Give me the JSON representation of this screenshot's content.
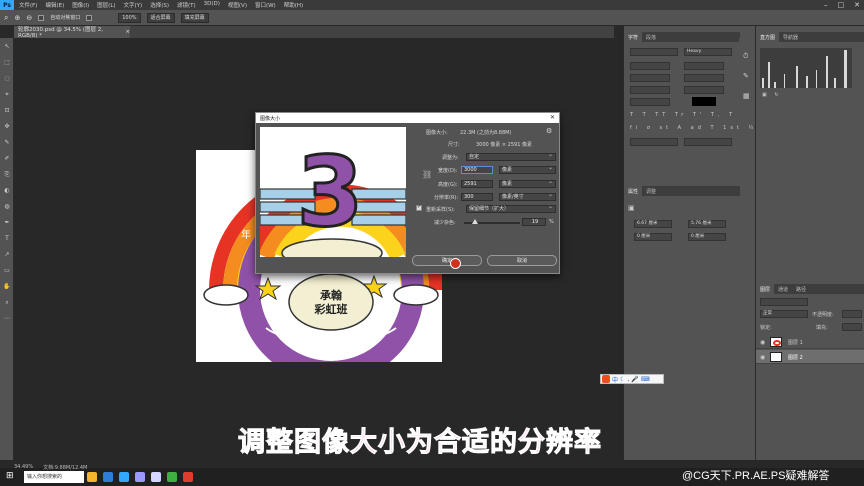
{
  "app": {
    "logo": "Ps",
    "menu": [
      "文件(F)",
      "编辑(E)",
      "图像(I)",
      "图层(L)",
      "文字(Y)",
      "选择(S)",
      "滤镜(T)",
      "3D(D)",
      "视图(V)",
      "窗口(W)",
      "帮助(H)"
    ],
    "window_controls": [
      "–",
      "□",
      "✕"
    ]
  },
  "options_bar": {
    "auto_select_label": "自动对焦窗口",
    "zoom_value": "100%",
    "fit_screen": "适合屏幕",
    "fill_screen": "填充屏幕"
  },
  "document_tab": {
    "title": "轮廓2030.psd @ 34.5% (图层 2, RGB/8) *",
    "close": "×"
  },
  "dialog": {
    "title": "图像大小",
    "close": "✕",
    "image_size_label": "图像大小:",
    "image_size_value": "22.3M (之前为8.88M)",
    "gear_icon": "gear-icon",
    "dimensions_label": "尺寸:",
    "dimensions_value": "3000 像素 × 2591 像素",
    "fit_label": "调整为:",
    "fit_value": "自定",
    "width_label": "宽度(D):",
    "width_value": "3000",
    "width_unit": "像素",
    "height_label": "高度(G):",
    "height_value": "2591",
    "height_unit": "像素",
    "resolution_label": "分辨率(R):",
    "resolution_value": "300",
    "resolution_unit": "像素/英寸",
    "resample_label": "重新采样(S):",
    "resample_checked": true,
    "resample_value": "保留细节（扩大）",
    "noise_label": "减少杂色:",
    "noise_value": "19",
    "noise_unit": "%",
    "noise_level": 0.19,
    "ok_label": "确定",
    "cancel_label": "取消"
  },
  "artwork": {
    "number": "3",
    "line1": "承翰",
    "line2": "彩虹班",
    "side_text": "年"
  },
  "right_panel": {
    "char_tabs": [
      "字符",
      "段落"
    ],
    "font_value": "Heavy",
    "props_tabs": [
      "属性",
      "调整"
    ],
    "histogram_tabs": [
      "直方图",
      "导航器"
    ],
    "layers_tabs": [
      "图层",
      "通道",
      "路径"
    ],
    "layer_kind": "正常",
    "opacity_label": "不透明度:",
    "lock_label": "锁定:",
    "fill_label": "填充:",
    "layers": [
      {
        "name": "图层 1",
        "selected": false
      },
      {
        "name": "图层 2",
        "selected": true
      }
    ],
    "props_w": "6.67 厘米",
    "props_h": "5.76 厘米",
    "props_x": "0 厘米",
    "props_y": "0 厘米"
  },
  "status": {
    "zoom": "34.49%",
    "doc": "文档:9.88M/12.4M"
  },
  "caption": "调整图像大小为合适的分辨率",
  "watermark": "@CG天下.PR.AE.PS疑难解答",
  "taskbar": {
    "search_placeholder": "输入你想搜索的"
  },
  "colors": {
    "rainbow": [
      "#e63324",
      "#f58c1f",
      "#fbd21c"
    ],
    "purple": "#8f52a8",
    "blue_band": "#a7cfe8",
    "caption_pink": "#ff5fb4",
    "ps_blue": "#31a8ff"
  }
}
